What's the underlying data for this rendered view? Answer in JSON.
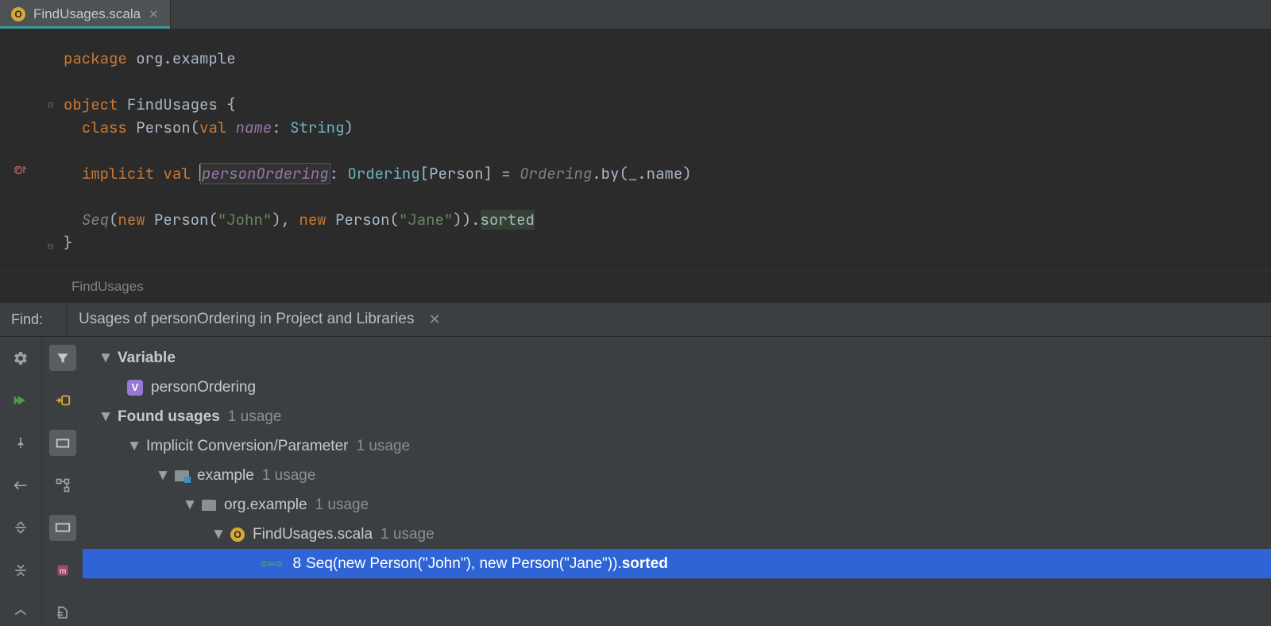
{
  "tab": {
    "filename": "FindUsages.scala"
  },
  "code": {
    "l1": {
      "package_kw": "package",
      "pkg": "org.example"
    },
    "l3": {
      "object_kw": "object",
      "name": "FindUsages",
      "brace": " {"
    },
    "l4": {
      "class_kw": "class",
      "name": "Person",
      "open": "(",
      "val_kw": "val",
      "param": "name",
      "colon": ": ",
      "type": "String",
      "close": ")"
    },
    "l6": {
      "implicit_kw": "implicit",
      "val_kw": "val",
      "var": "personOrdering",
      "colon": ": ",
      "type1": "Ordering",
      "br1": "[",
      "type2": "Person",
      "br2": "] = ",
      "call": "Ordering",
      "dot_by": ".by(_.name)"
    },
    "l8": {
      "seq": "Seq",
      "open": "(",
      "new_kw": "new",
      "p": "Person",
      "s1": "\"John\"",
      "comma": ", ",
      "s2": "\"Jane\"",
      "close": ").",
      "sorted": "sorted"
    },
    "l9": {
      "brace": "}"
    }
  },
  "breadcrumb": "FindUsages",
  "find": {
    "label": "Find:",
    "title": "Usages of personOrdering in Project and Libraries"
  },
  "tree": {
    "variable": "Variable",
    "varName": "personOrdering",
    "found": "Found usages",
    "foundCount": "1 usage",
    "cat": "Implicit Conversion/Parameter",
    "catCount": "1 usage",
    "mod": "example",
    "modCount": "1 usage",
    "pkg": "org.example",
    "pkgCount": "1 usage",
    "file": "FindUsages.scala",
    "fileCount": "1 usage",
    "hit_line": "8",
    "hit_pre": "Seq(new Person(\"John\"), new Person(\"Jane\")).",
    "hit_bold": "sorted"
  }
}
